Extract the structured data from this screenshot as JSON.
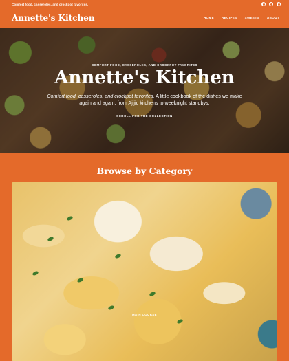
{
  "topbar": {
    "tagline": "Comfort food, casseroles, and crockpot favorites.",
    "social_icons": [
      "instagram-icon",
      "pinterest-icon",
      "facebook-icon"
    ]
  },
  "header": {
    "logo": "Annette's Kitchen",
    "nav": [
      "HOME",
      "RECIPES",
      "SWEETS",
      "ABOUT"
    ]
  },
  "hero": {
    "kicker": "COMFORT FOOD, CASSEROLES, AND CROCKPOT FAVORITES",
    "title": "Annette's Kitchen",
    "desc_italic": "Comfort food, casseroles, and crockpot favorites.",
    "desc_rest": " A little cookbook of the dishes we make again and again, from Ajijic kitchens to weeknight standbys.",
    "scroll": "SCROLL FOR THE COLLECTION"
  },
  "browse": {
    "title": "Browse by Category",
    "card_label": "MAIN COURSE"
  },
  "colors": {
    "brand": "#e46a2a",
    "text": "#ffffff"
  }
}
